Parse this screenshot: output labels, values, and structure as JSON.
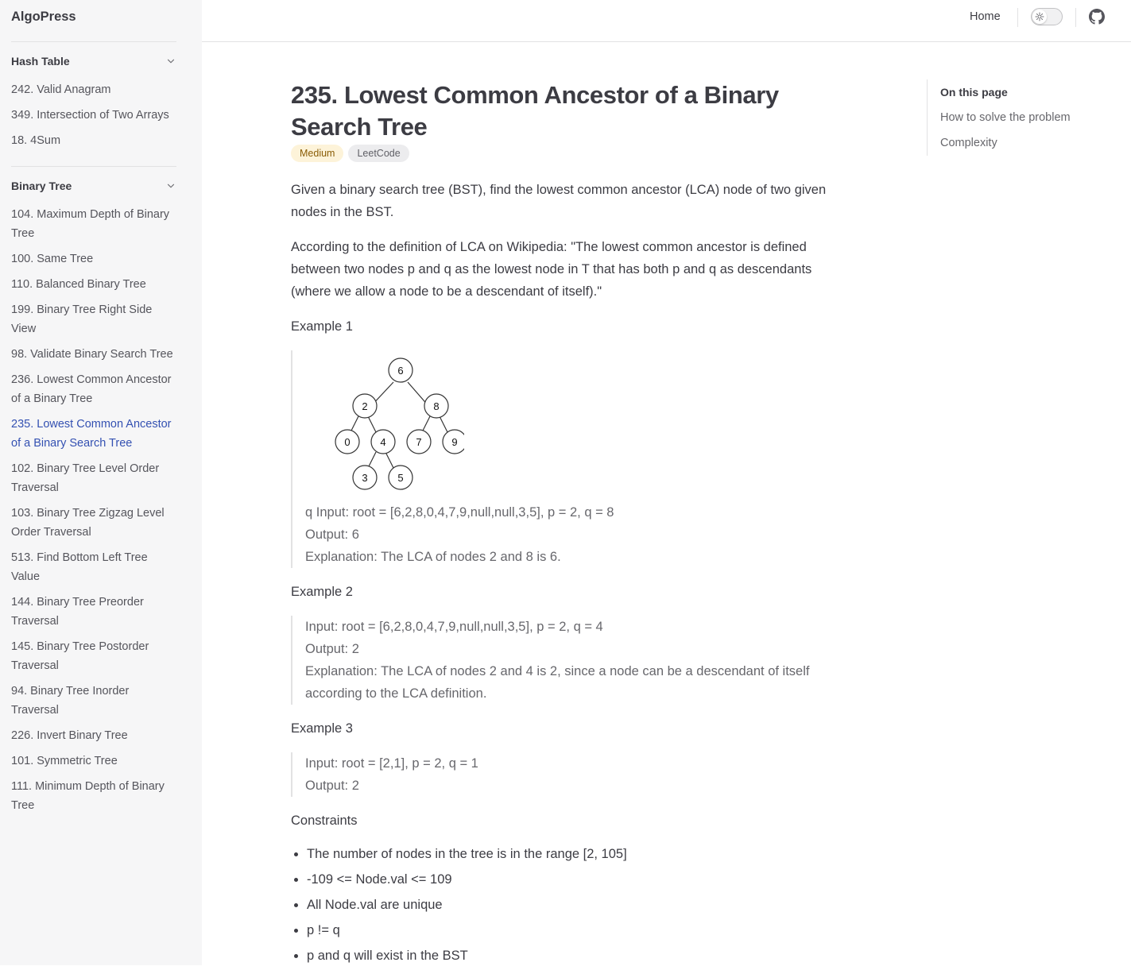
{
  "brand": "AlgoPress",
  "nav": {
    "home": "Home",
    "theme_toggle_icon": "sun-icon",
    "github_icon": "github-icon"
  },
  "sidebar": {
    "groups": [
      {
        "title": "Hash Table",
        "items": [
          {
            "label": "242. Valid Anagram"
          },
          {
            "label": "349. Intersection of Two Arrays"
          },
          {
            "label": "18. 4Sum"
          }
        ]
      },
      {
        "title": "Binary Tree",
        "items": [
          {
            "label": "104. Maximum Depth of Binary Tree"
          },
          {
            "label": "100. Same Tree"
          },
          {
            "label": "110. Balanced Binary Tree"
          },
          {
            "label": "199. Binary Tree Right Side View"
          },
          {
            "label": "98. Validate Binary Search Tree"
          },
          {
            "label": "236. Lowest Common Ancestor of a Binary Tree"
          },
          {
            "label": "235. Lowest Common Ancestor of a Binary Search Tree",
            "active": true
          },
          {
            "label": "102. Binary Tree Level Order Traversal"
          },
          {
            "label": "103. Binary Tree Zigzag Level Order Traversal"
          },
          {
            "label": "513. Find Bottom Left Tree Value"
          },
          {
            "label": "144. Binary Tree Preorder Traversal"
          },
          {
            "label": "145. Binary Tree Postorder Traversal"
          },
          {
            "label": "94. Binary Tree Inorder Traversal"
          },
          {
            "label": "226. Invert Binary Tree"
          },
          {
            "label": "101. Symmetric Tree"
          },
          {
            "label": "111. Minimum Depth of Binary Tree"
          }
        ]
      }
    ]
  },
  "page": {
    "title": "235. Lowest Common Ancestor of a Binary Search Tree",
    "badges": [
      "Medium",
      "LeetCode"
    ],
    "intro": "Given a binary search tree (BST), find the lowest common ancestor (LCA) node of two given nodes in the BST.",
    "definition": "According to the definition of LCA on Wikipedia: \"The lowest common ancestor is defined between two nodes p and q as the lowest node in T that has both p and q as descendants (where we allow a node to be a descendant of itself).\"",
    "example1": {
      "heading": "Example 1",
      "tree_nodes": [
        "6",
        "2",
        "8",
        "0",
        "4",
        "7",
        "9",
        "3",
        "5"
      ],
      "lines": [
        "q Input: root = [6,2,8,0,4,7,9,null,null,3,5], p = 2, q = 8",
        "Output: 6",
        "Explanation: The LCA of nodes 2 and 8 is 6."
      ]
    },
    "example2": {
      "heading": "Example 2",
      "lines": [
        "Input: root = [6,2,8,0,4,7,9,null,null,3,5], p = 2, q = 4",
        "Output: 2",
        "Explanation: The LCA of nodes 2 and 4 is 2, since a node can be a descendant of itself according to the LCA definition."
      ]
    },
    "example3": {
      "heading": "Example 3",
      "lines": [
        "Input: root = [2,1], p = 2, q = 1",
        "Output: 2"
      ]
    },
    "constraints": {
      "heading": "Constraints",
      "items": [
        "The number of nodes in the tree is in the range [2, 105]",
        "-109 <= Node.val <= 109",
        "All Node.val are unique",
        "p != q",
        "p and q will exist in the BST"
      ]
    }
  },
  "aside": {
    "title": "On this page",
    "links": [
      "How to solve the problem",
      "Complexity"
    ]
  },
  "colors": {
    "accent": "#3451b2",
    "badge_medium_bg": "#fdf3d9",
    "badge_medium_text": "#8a5d06"
  }
}
